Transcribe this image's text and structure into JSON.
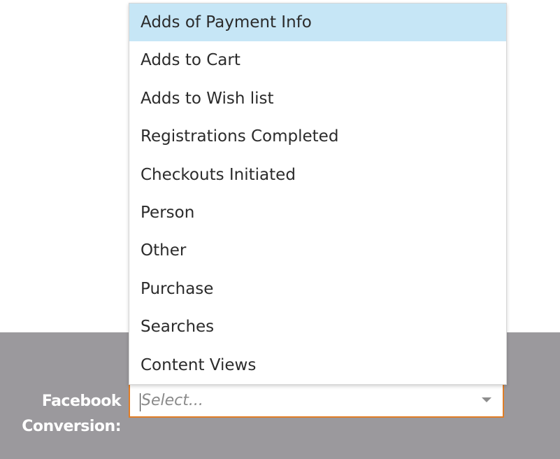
{
  "field": {
    "label_line1": "Facebook",
    "label_line2": "Conversion:",
    "placeholder": "Select..."
  },
  "dropdown": {
    "highlighted_index": 0,
    "options": [
      "Adds of Payment Info",
      "Adds to Cart",
      "Adds to Wish list",
      "Registrations Completed",
      "Checkouts Initiated",
      "Person",
      "Other",
      "Purchase",
      "Searches",
      "Content Views"
    ]
  },
  "colors": {
    "panel_background": "#9b999d",
    "focus_border": "#e07d26",
    "highlight": "#c6e6f6"
  },
  "icons": {
    "dropdown_arrow": "chevron-down-icon"
  }
}
